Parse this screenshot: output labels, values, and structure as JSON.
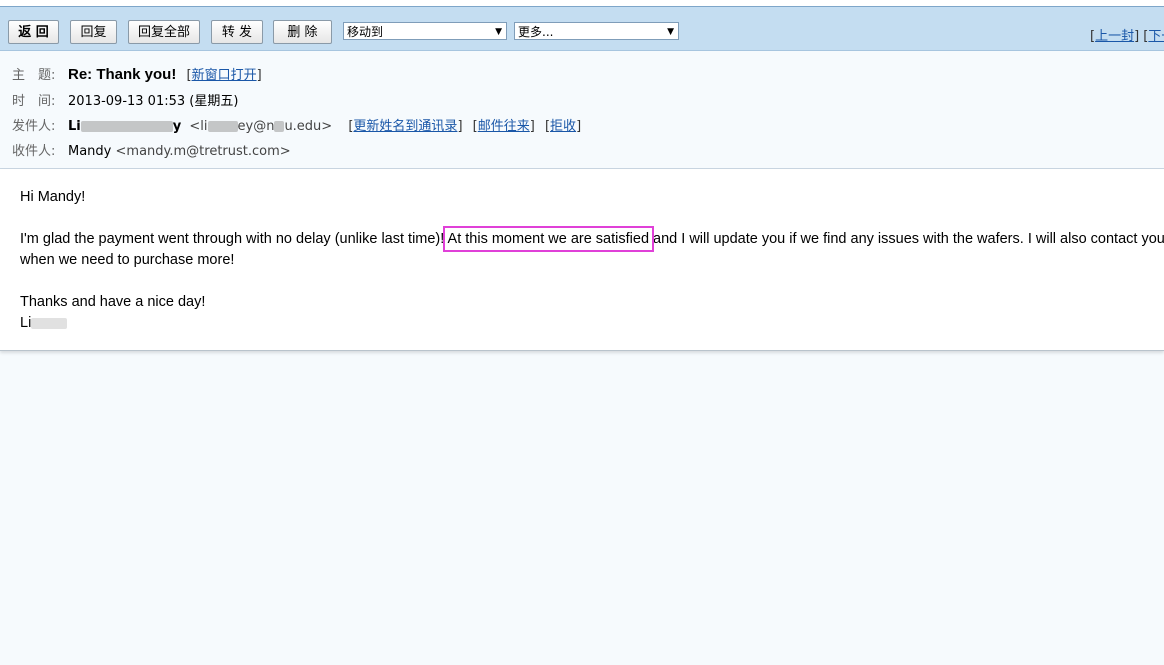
{
  "toolbar": {
    "back_label": "返 回",
    "reply_label": "回复",
    "reply_all_label": "回复全部",
    "forward_label": "转 发",
    "delete_label": "删 除",
    "move_to": "移动到",
    "more": "更多...",
    "prev_label": "上一封",
    "next_label": "下一"
  },
  "header": {
    "subject_label": "主　题:",
    "subject": "Re: Thank you!",
    "open_new_window": "新窗口打开",
    "time_label": "时　间:",
    "time": "2013-09-13 01:53 (星期五)",
    "from_label": "发件人:",
    "from_name_start": "Li",
    "from_name_end": "y",
    "from_email_start": "<li",
    "from_email_mid": "ey@n",
    "from_email_end": "u.edu>",
    "update_contact": "更新姓名到通讯录",
    "mail_history": "邮件往来",
    "reject": "拒收",
    "to_label": "收件人:",
    "to_name": "Mandy",
    "to_email": "<mandy.m@tretrust.com>"
  },
  "body": {
    "greeting": "Hi Mandy!",
    "line1_before": "I'm glad the payment went through with no delay (unlike last time)! ",
    "line1_highlight": "At this moment we are satisfied",
    "line1_after": " and I will update you if we find any issues with the wafers. I will also contact you",
    "line2": "when we need to purchase more!",
    "closing": "Thanks and have a nice day!",
    "signature_start": "Li"
  },
  "colors": {
    "toolbar_bg": "#c4ddf1",
    "highlight": "#e040d8",
    "link": "#1a57a8"
  }
}
